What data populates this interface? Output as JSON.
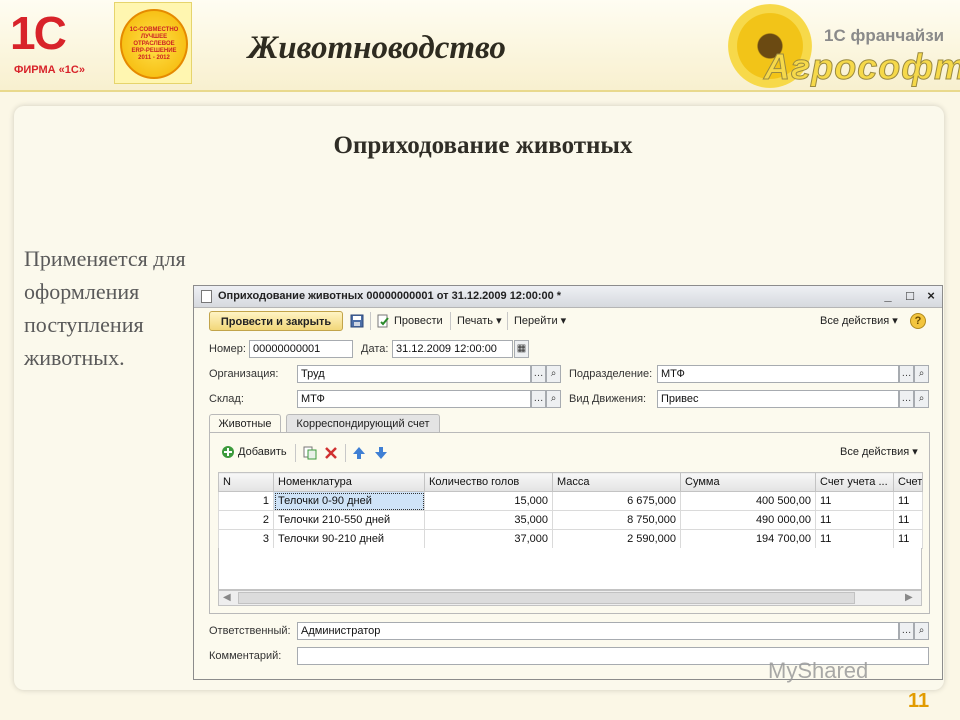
{
  "slide": {
    "title": "Животноводство",
    "subtitle": "Оприходование животных",
    "bullet_text": "Применяется для оформления поступления животных.",
    "page_number": "11",
    "logo_1c_text": "1С",
    "logo_firm_text": "ФИРМА «1С»",
    "seal_text": "1С-СОВМЕСТНО\nЛУЧШЕЕ\nОТРАСЛЕВОЕ\nERP-РЕШЕНИЕ\n2011 - 2012",
    "franchise_text": "1С франчайзи",
    "brand_name": "Агрософт",
    "watermark": "MyShared"
  },
  "window": {
    "title": "Оприходование животных 00000000001 от 31.12.2009 12:00:00 *",
    "controls": [
      "_",
      "□",
      "×"
    ],
    "toolbar": {
      "post_close": "Провести и закрыть",
      "post": "Провести",
      "print": "Печать ▾",
      "goto": "Перейти ▾",
      "all_actions": "Все действия ▾",
      "help": "?"
    },
    "fields": {
      "number_label": "Номер:",
      "number_value": "00000000001",
      "date_label": "Дата:",
      "date_value": "31.12.2009 12:00:00",
      "org_label": "Организация:",
      "org_value": "Труд",
      "dept_label": "Подразделение:",
      "dept_value": "МТФ",
      "warehouse_label": "Склад:",
      "warehouse_value": "МТФ",
      "movement_label": "Вид Движения:",
      "movement_value": "Привес",
      "responsible_label": "Ответственный:",
      "responsible_value": "Администратор",
      "comment_label": "Комментарий:",
      "comment_value": ""
    },
    "tabs": [
      "Животные",
      "Корреспондирующий счет"
    ],
    "grid_toolbar": {
      "add": "Добавить",
      "all_actions": "Все действия ▾"
    },
    "table": {
      "columns": [
        "N",
        "Номенклатура",
        "Количество голов",
        "Масса",
        "Сумма",
        "Счет учета ...",
        "Счет"
      ],
      "rows": [
        [
          "1",
          "Телочки 0-90 дней",
          "15,000",
          "6 675,000",
          "400 500,00",
          "11",
          "11"
        ],
        [
          "2",
          "Телочки 210-550 дней",
          "35,000",
          "8 750,000",
          "490 000,00",
          "11",
          "11"
        ],
        [
          "3",
          "Телочки 90-210 дней",
          "37,000",
          "2 590,000",
          "194 700,00",
          "11",
          "11"
        ]
      ]
    }
  },
  "icons": {
    "save": "save-icon",
    "post": "post-icon",
    "add": "add-icon",
    "copy": "copy-icon",
    "delete": "delete-icon",
    "up": "arrow-up-icon",
    "down": "arrow-down-icon",
    "select": "ellipsis-icon",
    "search": "magnifier-icon",
    "calendar": "calendar-icon"
  },
  "colors": {
    "accent": "#f2d77a",
    "selection": "#cfe3f7",
    "page_number": "#e29b00",
    "title_red": "#d8232a"
  }
}
